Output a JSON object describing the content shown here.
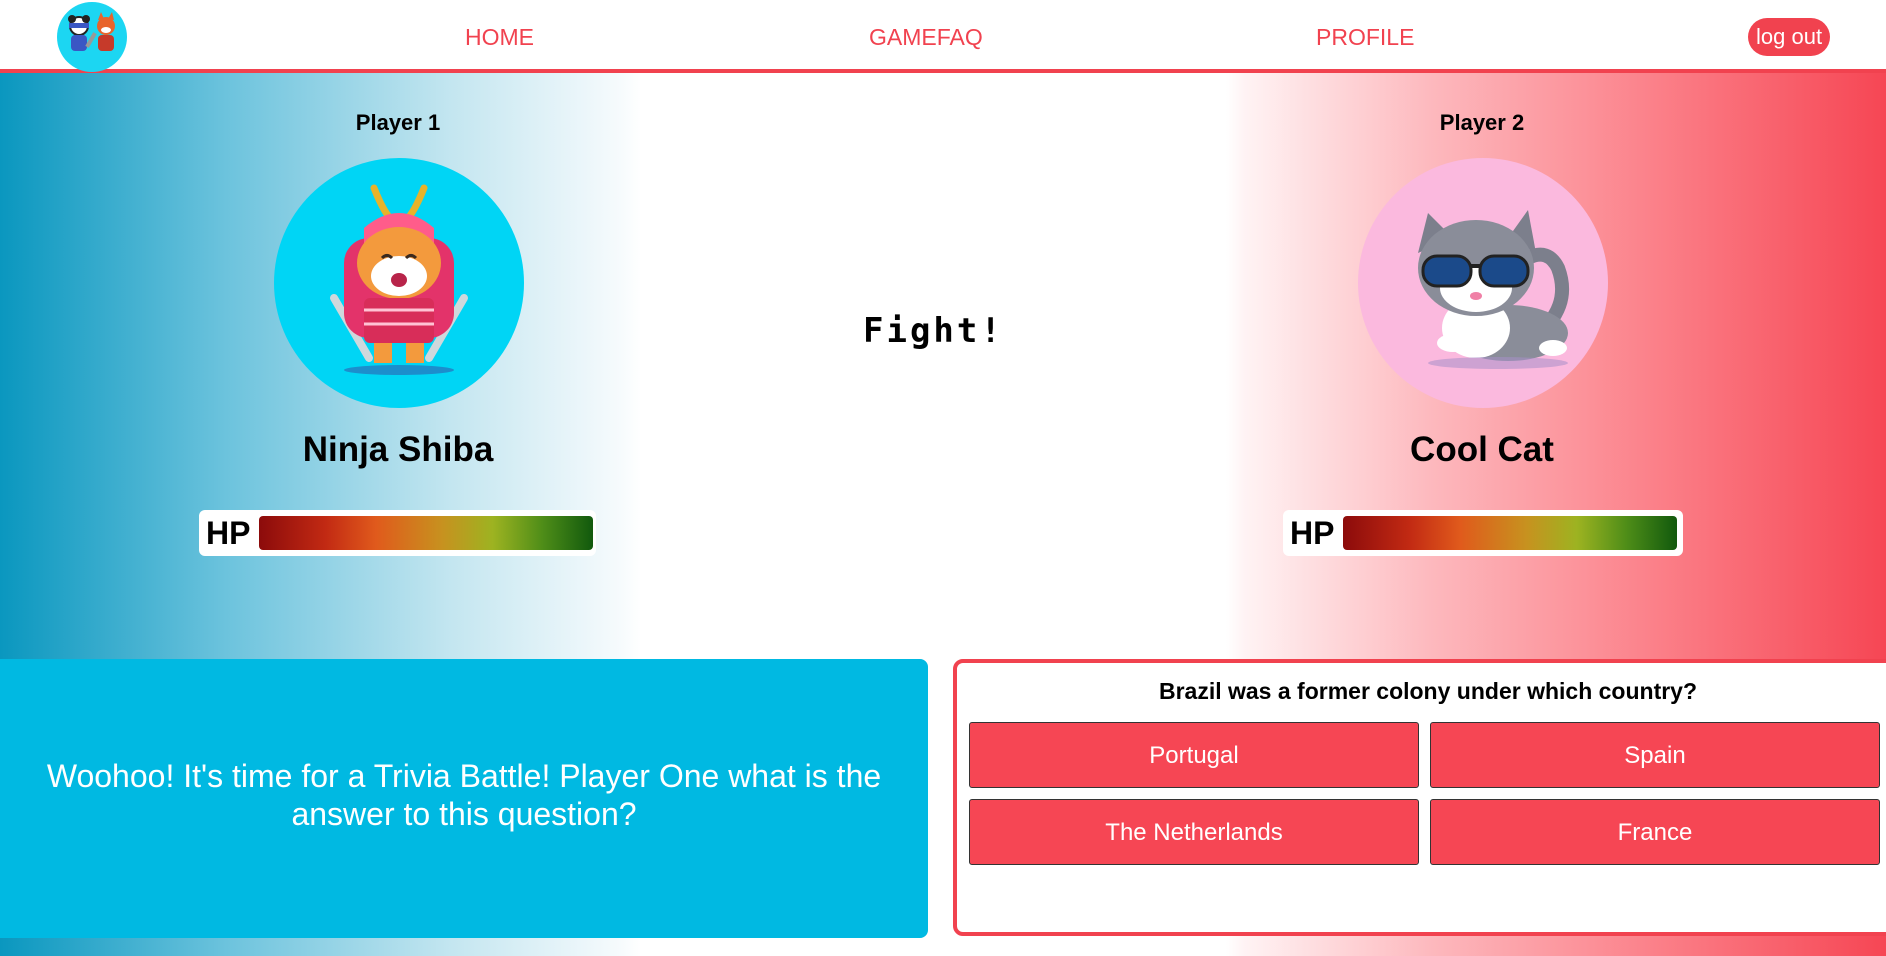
{
  "nav": {
    "home": "HOME",
    "gamefaq": "GAMEFAQ",
    "profile": "PROFILE",
    "logout": "log out"
  },
  "players": [
    {
      "label": "Player 1",
      "name": "Ninja Shiba",
      "hp_label": "HP",
      "hp_percent": 100,
      "avatar_bg": "#00d5f5"
    },
    {
      "label": "Player 2",
      "name": "Cool Cat",
      "hp_label": "HP",
      "hp_percent": 100,
      "avatar_bg": "#fbb9de"
    }
  ],
  "fight_text": "Fight!",
  "message": "Woohoo! It's time for a Trivia Battle! Player One what is the answer to this question?",
  "question": {
    "text": "Brazil was a former colony under which country?",
    "answers": [
      "Portugal",
      "Spain",
      "The Netherlands",
      "France"
    ]
  },
  "colors": {
    "accent": "#f1424f",
    "message_panel": "#00b9e2"
  }
}
